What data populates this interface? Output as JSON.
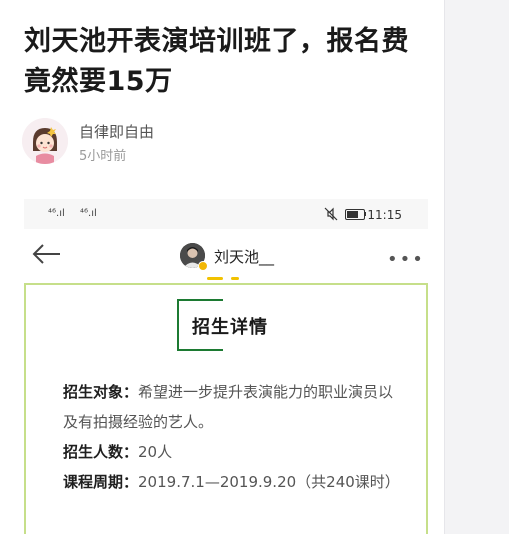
{
  "article": {
    "title": "刘天池开表演培训班了，报名费竟然要15万",
    "author": "自律即自由",
    "time": "5小时前"
  },
  "screenshot": {
    "status_bar": {
      "signal_left": "⁴⁶.ıl",
      "signal_right": "⁴⁶.ıl",
      "time": "11:15"
    },
    "nav": {
      "profile_name": "刘天池__"
    },
    "detail": {
      "section_title": "招生详情",
      "target_label": "招生对象：",
      "target_value": "希望进一步提升表演能力的职业演员以及有拍摄经验的艺人。",
      "count_label": "招生人数：",
      "count_value": "20人",
      "period_label": "课程周期：",
      "period_value": "2019.7.1—2019.9.20（共240课时）"
    }
  },
  "colors": {
    "card_border": "#c6df8a",
    "section_frame": "#1c7a32",
    "story_bar": "#f2c200"
  }
}
